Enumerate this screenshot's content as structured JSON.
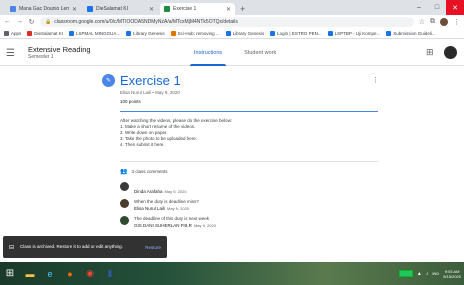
{
  "browser": {
    "tabs": [
      {
        "label": "Mana Gac Dounio Lem / K",
        "active": false,
        "color": "#4a86e8"
      },
      {
        "label": "DieSalamat KI",
        "active": false,
        "color": "#1a73e8"
      },
      {
        "label": "Exercise 1",
        "active": true,
        "color": "#1e8e3e"
      }
    ],
    "new_tab": "+",
    "window_controls": {
      "minimize": "–",
      "maximize": "□",
      "close": "✕"
    },
    "address": "classroom.google.com/u/0/c/MTIOODA5NDMyNzA/a/MTcxMjM4NTk5OTQx/details",
    "bookmarks": [
      {
        "label": "Apps",
        "color": "#5f6368"
      },
      {
        "label": "DieSalamat KI",
        "color": "#d93025"
      },
      {
        "label": "LSPMAL MINGGUA...",
        "color": "#1a73e8"
      },
      {
        "label": "Library Genesis",
        "color": "#1a73e8"
      },
      {
        "label": "Sci-Hub: removing ...",
        "color": "#e37400"
      },
      {
        "label": "Library Genesis",
        "color": "#1a73e8"
      },
      {
        "label": "Login | ESTRO PEN...",
        "color": "#1a73e8"
      },
      {
        "label": "LSPTBP - Uji Kompe...",
        "color": "#1a73e8"
      },
      {
        "label": "Submission Guideli...",
        "color": "#1a73e8"
      }
    ]
  },
  "classroom": {
    "class_name": "Extensive Reading",
    "class_section": "Semester 1",
    "tabs": [
      "Instructions",
      "Student work"
    ],
    "active_tab": 0
  },
  "assignment": {
    "title": "Exercise 1",
    "meta": "Elisa Nurul Laili • May 9, 2020",
    "points": "100 points",
    "instructions": [
      "After watching the videos, please do the exercise below:",
      "1. Make a short resume of the videos.",
      "2. Write down on paper.",
      "3. Take the photo to be uploaded here.",
      "4. Then submit it here."
    ],
    "comments_header": "3 class comments",
    "comments": [
      {
        "name": "Dinda Arafaha",
        "date": "May 9, 2020",
        "text": "When the duty is deadline miss?"
      },
      {
        "name": "Elisa Nurul Laili",
        "date": "May 9, 2020",
        "text": "The deadline of this duty is next week"
      },
      {
        "name": "GIS DANI SUHERLAN P.B.R",
        "date": "May 9, 2020",
        "text": ""
      }
    ]
  },
  "snackbar": {
    "text": "Class is archived. Restore it to add or edit anything.",
    "action": "Restore"
  },
  "taskbar": {
    "lang": "IND",
    "time": "9:03 AM",
    "date": "5/15/2020"
  }
}
